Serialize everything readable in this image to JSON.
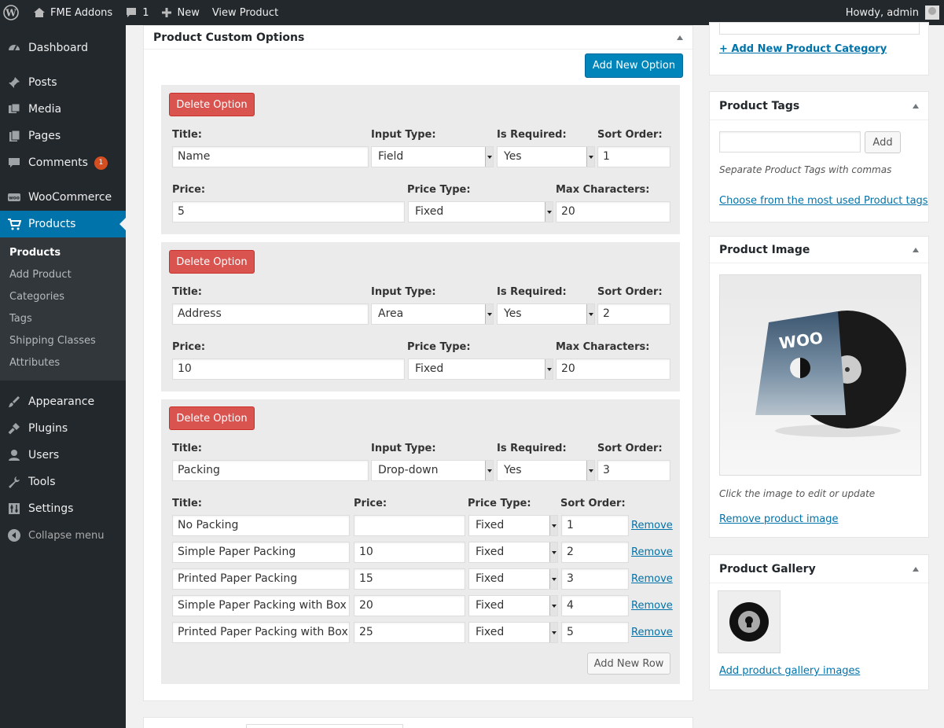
{
  "adminbar": {
    "site_name": "FME Addons",
    "comments_count": "1",
    "new_label": "New",
    "view_label": "View Product",
    "howdy": "Howdy, admin"
  },
  "sidebar": {
    "items": [
      {
        "label": "Dashboard",
        "icon": "dashboard-icon"
      },
      {
        "label": "Posts",
        "icon": "pin-icon"
      },
      {
        "label": "Media",
        "icon": "media-icon"
      },
      {
        "label": "Pages",
        "icon": "pages-icon"
      },
      {
        "label": "Comments",
        "icon": "comment-icon",
        "badge": "1"
      },
      {
        "label": "WooCommerce",
        "icon": "woo-icon"
      },
      {
        "label": "Products",
        "icon": "cart-icon",
        "active": true
      },
      {
        "label": "Appearance",
        "icon": "brush-icon"
      },
      {
        "label": "Plugins",
        "icon": "plug-icon"
      },
      {
        "label": "Users",
        "icon": "user-icon"
      },
      {
        "label": "Tools",
        "icon": "wrench-icon"
      },
      {
        "label": "Settings",
        "icon": "settings-icon"
      }
    ],
    "submenu": [
      "Products",
      "Add Product",
      "Categories",
      "Tags",
      "Shipping Classes",
      "Attributes"
    ],
    "collapse": "Collapse menu"
  },
  "options_box": {
    "title": "Product Custom Options",
    "add_option": "Add New Option",
    "delete_label": "Delete Option",
    "labels": {
      "title": "Title:",
      "input_type": "Input Type:",
      "is_required": "Is Required:",
      "sort_order": "Sort Order:",
      "price": "Price:",
      "price_type": "Price Type:",
      "max_chars": "Max Characters:"
    },
    "groups": [
      {
        "title": "Name",
        "input_type": "Field",
        "required": "Yes",
        "sort": "1",
        "price": "5",
        "price_type": "Fixed",
        "max_chars": "20"
      },
      {
        "title": "Address",
        "input_type": "Area",
        "required": "Yes",
        "sort": "2",
        "price": "10",
        "price_type": "Fixed",
        "max_chars": "20"
      },
      {
        "title": "Packing",
        "input_type": "Drop-down",
        "required": "Yes",
        "sort": "3"
      }
    ],
    "rows": [
      {
        "title": "No Packing",
        "price": "",
        "price_type": "Fixed",
        "sort": "1"
      },
      {
        "title": "Simple Paper Packing",
        "price": "10",
        "price_type": "Fixed",
        "sort": "2"
      },
      {
        "title": "Printed Paper Packing",
        "price": "15",
        "price_type": "Fixed",
        "sort": "3"
      },
      {
        "title": "Simple Paper Packing with Box",
        "price": "20",
        "price_type": "Fixed",
        "sort": "4"
      },
      {
        "title": "Printed Paper Packing with Box",
        "price": "25",
        "price_type": "Fixed",
        "sort": "5"
      }
    ],
    "remove_label": "Remove",
    "add_row": "Add New Row"
  },
  "right": {
    "add_category": "+ Add New Product Category",
    "tags": {
      "title": "Product Tags",
      "add": "Add",
      "hint": "Separate Product Tags with commas",
      "choose": "Choose from the most used Product tags"
    },
    "image": {
      "title": "Product Image",
      "cover_text": "WOO",
      "hint": "Click the image to edit or update",
      "remove": "Remove product image"
    },
    "gallery": {
      "title": "Product Gallery",
      "add": "Add product gallery images"
    }
  },
  "colors": {
    "accent": "#0073aa",
    "button_blue": "#0085ba",
    "delete_red": "#d9534f",
    "sidebar": "#23282d"
  }
}
